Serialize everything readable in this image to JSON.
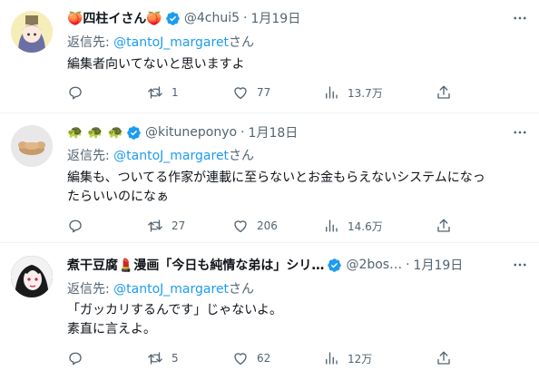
{
  "tweets": [
    {
      "display_name": "🍑四柱イさん🍑",
      "handle": "@4chui5",
      "date": "1月19日",
      "reply_prefix": "返信先:",
      "reply_mention": "@tantoJ_margaret",
      "reply_suffix": "さん",
      "lines": [
        "編集者向いてないと思いますよ"
      ],
      "reply_count": "",
      "retweet_count": "1",
      "like_count": "77",
      "view_count": "13.7万"
    },
    {
      "display_name": "🐢 🐢 🐢",
      "handle": "@kituneponyo",
      "date": "1月18日",
      "reply_prefix": "返信先:",
      "reply_mention": "@tantoJ_margaret",
      "reply_suffix": "さん",
      "lines": [
        "編集も、ついてる作家が連載に至らないとお金もらえないシステムになっ",
        "たらいいのになぁ"
      ],
      "reply_count": "",
      "retweet_count": "27",
      "like_count": "206",
      "view_count": "14.6万"
    },
    {
      "display_name": "煮干豆腐💄漫画「今日も純情な弟は」シリ…",
      "handle": "@2bos…",
      "date": "1月19日",
      "reply_prefix": "返信先:",
      "reply_mention": "@tantoJ_margaret",
      "reply_suffix": "さん",
      "lines": [
        "「ガッカリするんです」じゃないよ。",
        "素直に言えよ。"
      ],
      "reply_count": "",
      "retweet_count": "5",
      "like_count": "62",
      "view_count": "12万"
    }
  ],
  "colors": {
    "accent": "#1d9bf0",
    "secondary_text": "#536471",
    "divider": "#eff3f4"
  },
  "icons": [
    "verified-badge-icon",
    "more-icon",
    "reply-icon",
    "retweet-icon",
    "like-icon",
    "views-icon",
    "share-icon"
  ]
}
